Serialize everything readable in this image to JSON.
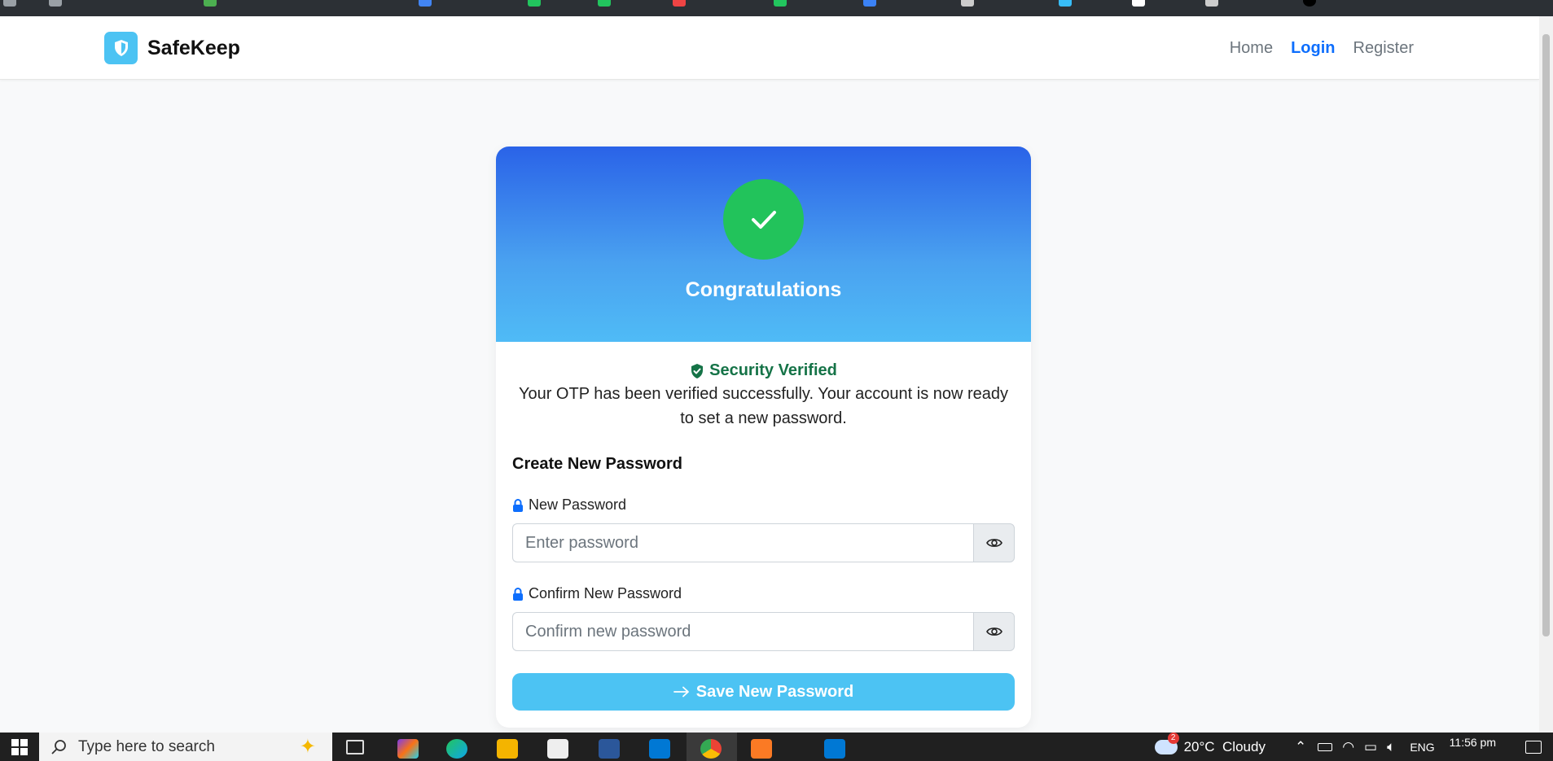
{
  "browser": {
    "bookmark_colors": [
      "#9aa0a6",
      "#4caf50",
      "#4285f4",
      "#22c55e",
      "#22c55e",
      "#ef4444",
      "#22c55e",
      "#3b82f6",
      "#cccccc",
      "#38bdf8",
      "#ffffff",
      "#cccccc",
      "#000000"
    ]
  },
  "nav": {
    "brand": "SafeKeep",
    "links": [
      {
        "label": "Home",
        "active": false
      },
      {
        "label": "Login",
        "active": true
      },
      {
        "label": "Register",
        "active": false
      }
    ]
  },
  "card": {
    "title": "Congratulations",
    "verified_label": "Security Verified",
    "verified_message": "Your OTP has been verified successfully. Your account is now ready to set a new password.",
    "section_title": "Create New Password",
    "new_password": {
      "label": "New Password",
      "placeholder": "Enter password"
    },
    "confirm_password": {
      "label": "Confirm New Password",
      "placeholder": "Confirm new password"
    },
    "save_button": "Save New Password"
  },
  "taskbar": {
    "search_placeholder": "Type here to search",
    "weather": "20°C  Cloudy",
    "weather_badge": "2",
    "language": "ENG",
    "time": "11:56 pm",
    "apps": [
      "copilot",
      "edge",
      "file-explorer",
      "store",
      "word",
      "outlook",
      "chrome",
      "xampp",
      "vscode"
    ]
  },
  "colors": {
    "accent": "#0d6efd",
    "brand": "#4cc3f3",
    "success": "#22c35b",
    "verified_text": "#157347"
  }
}
